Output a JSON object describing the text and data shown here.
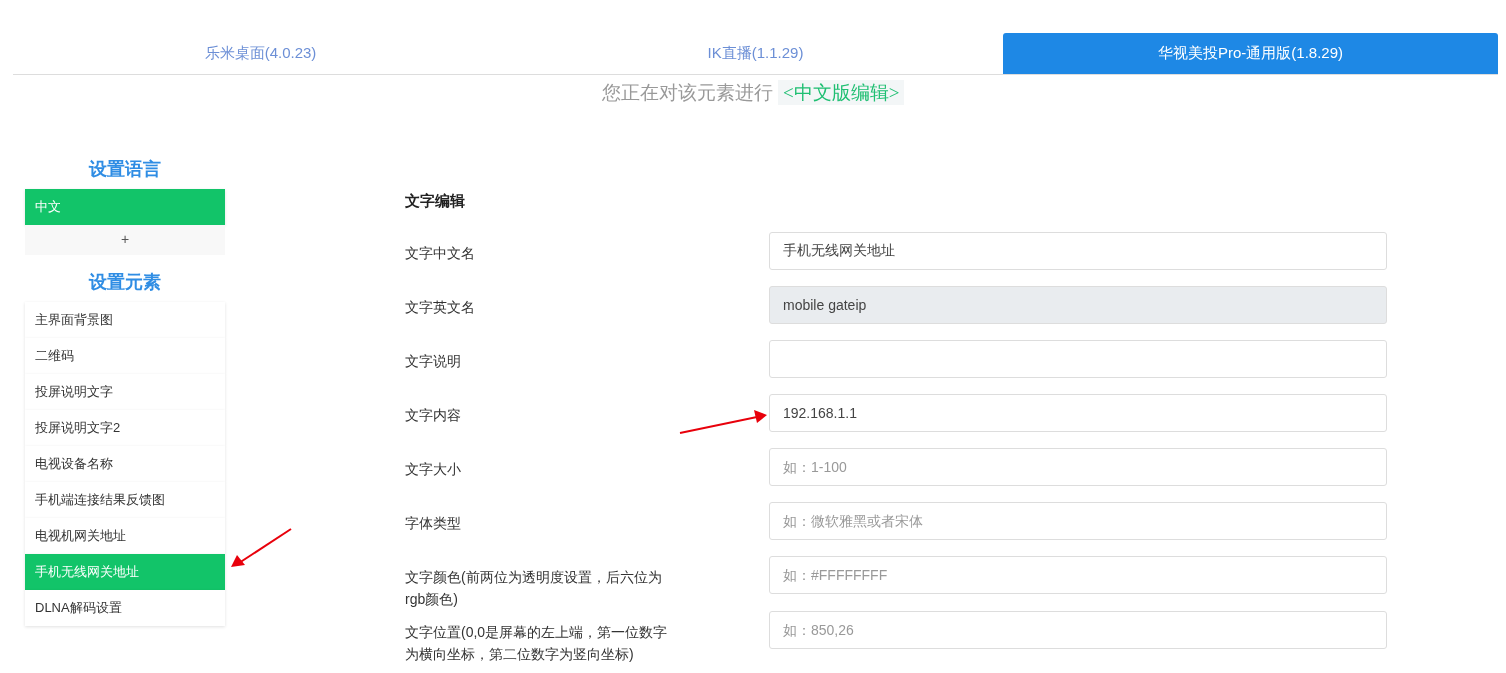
{
  "tabs": [
    {
      "label": "乐米桌面(4.0.23)",
      "selected": false
    },
    {
      "label": "IK直播(1.1.29)",
      "selected": false
    },
    {
      "label": "华视美投Pro-通用版(1.8.29)",
      "selected": true
    }
  ],
  "notice": {
    "text": "您正在对该元素进行",
    "tag": "<中文版编辑>"
  },
  "sidebar": {
    "language_title": "设置语言",
    "languages": [
      {
        "label": "中文",
        "selected": true
      }
    ],
    "add_label": "+",
    "element_title": "设置元素",
    "elements": [
      {
        "label": "主界面背景图",
        "selected": false
      },
      {
        "label": "二维码",
        "selected": false
      },
      {
        "label": "投屏说明文字",
        "selected": false
      },
      {
        "label": "投屏说明文字2",
        "selected": false
      },
      {
        "label": "电视设备名称",
        "selected": false
      },
      {
        "label": "手机端连接结果反馈图",
        "selected": false
      },
      {
        "label": "电视机网关地址",
        "selected": false
      },
      {
        "label": "手机无线网关地址",
        "selected": true
      },
      {
        "label": "DLNA解码设置",
        "selected": false
      }
    ]
  },
  "form": {
    "title": "文字编辑",
    "fields": [
      {
        "label": "文字中文名",
        "value": "手机无线网关地址",
        "disabled": false
      },
      {
        "label": "文字英文名",
        "value": "mobile gateip",
        "disabled": true
      },
      {
        "label": "文字说明",
        "disabled": false
      },
      {
        "label": "文字内容",
        "value": "192.168.1.1",
        "disabled": false
      },
      {
        "label": "文字大小",
        "placeholder": "如：1-100",
        "disabled": false
      },
      {
        "label": "字体类型",
        "placeholder": "如：微软雅黑或者宋体",
        "disabled": false
      },
      {
        "label": "文字颜色(前两位为透明度设置，后六位为rgb颜色)",
        "placeholder": "如：#FFFFFFFF",
        "disabled": false
      },
      {
        "label": "文字位置(0,0是屏幕的左上端，第一位数字为横向坐标，第二位数字为竖向坐标)",
        "placeholder": "如：850,26",
        "disabled": false
      }
    ]
  }
}
